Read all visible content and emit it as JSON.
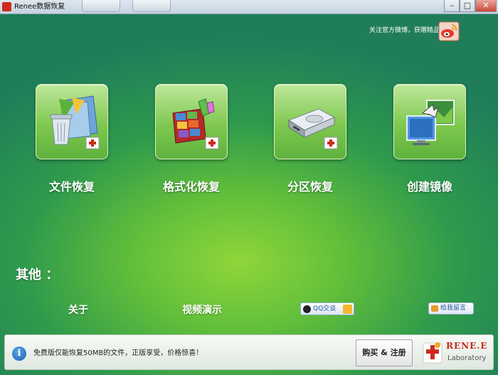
{
  "window": {
    "title": "Renee数据恢复"
  },
  "header": {
    "follow_text": "关注官方微博，获赠精品软件"
  },
  "features": [
    {
      "label": "文件恢复",
      "icon": "file-recovery-icon"
    },
    {
      "label": "格式化恢复",
      "icon": "format-recovery-icon"
    },
    {
      "label": "分区恢复",
      "icon": "partition-recovery-icon"
    },
    {
      "label": "创建镜像",
      "icon": "create-image-icon"
    }
  ],
  "other": {
    "title": "其他 ：",
    "about_label": "关于",
    "video_label": "视频演示",
    "qq_label": "QQ交谈",
    "message_label": "给我留言"
  },
  "footer": {
    "notice": "免费版仅能恢复50MB的文件，正版享受，价格惊喜！",
    "buy_label": "购买 & 注册",
    "brand_name": "RENE.E",
    "brand_sub": "Laboratory"
  },
  "colors": {
    "accent_red": "#cc2a1e",
    "bg_green": "#2f9a4c",
    "glow_green": "#8fd63a"
  }
}
